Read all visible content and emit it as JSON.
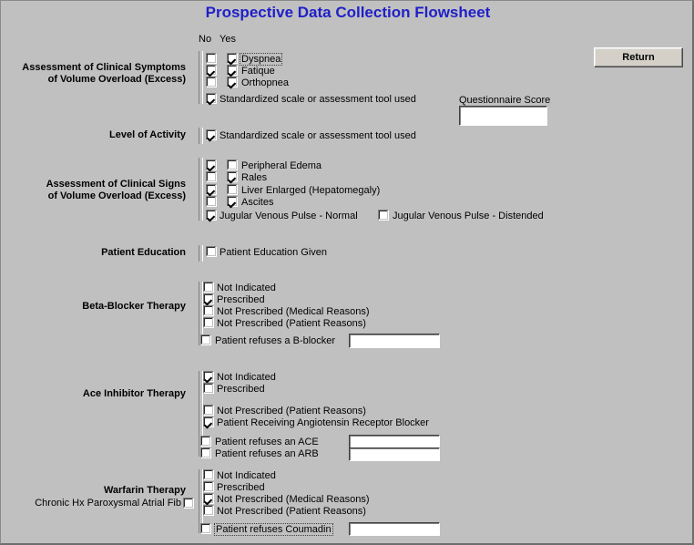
{
  "window": {
    "title": "Prospective Data Collection Flowsheet",
    "background_color": "#c0c0c0",
    "title_color": "#2020c8"
  },
  "buttons": {
    "return_label": "Return"
  },
  "column_headers": {
    "no": "No",
    "yes": "Yes"
  },
  "questionnaire": {
    "label": "Questionnaire Score",
    "value": "",
    "placeholder": ""
  },
  "sections": [
    {
      "id": "clinical-symptoms",
      "label": "Assessment of Clinical Symptoms\nof Volume Overload (Excess)",
      "rows": [
        {
          "text": "Dyspnea",
          "no": false,
          "yes": true,
          "focus": true
        },
        {
          "text": "Fatique",
          "no": true,
          "yes": true,
          "focus": false
        },
        {
          "text": "Orthopnea",
          "no": false,
          "yes": true,
          "focus": false
        }
      ],
      "single": {
        "text": "Standardized scale or assessment tool used",
        "checked": true
      }
    },
    {
      "id": "level-of-activity",
      "label": "Level of Activity",
      "single": {
        "text": "Standardized scale or assessment tool used",
        "checked": true
      }
    },
    {
      "id": "clinical-signs",
      "label": "Assessment of Clinical Signs\nof Volume Overload (Excess)",
      "rows": [
        {
          "text": "Peripheral Edema",
          "no": true,
          "yes": false,
          "focus": false
        },
        {
          "text": "Rales",
          "no": false,
          "yes": true,
          "focus": false
        },
        {
          "text": "Liver Enlarged (Hepatomegaly)",
          "no": true,
          "yes": false,
          "focus": false
        },
        {
          "text": "Ascites",
          "no": false,
          "yes": true,
          "focus": false
        }
      ],
      "single": {
        "text": "Jugular Venous Pulse - Normal",
        "checked": true
      },
      "extra": {
        "text": "Jugular Venous Pulse - Distended",
        "checked": false
      }
    },
    {
      "id": "patient-education",
      "label": "Patient Education",
      "single": {
        "text": "Patient Education Given",
        "checked": false
      }
    },
    {
      "id": "beta-blocker-therapy",
      "label": "Beta-Blocker Therapy",
      "options": [
        {
          "text": "Not Indicated",
          "checked": false
        },
        {
          "text": "Prescribed",
          "checked": true
        },
        {
          "text": "Not Prescribed (Medical Reasons)",
          "checked": false
        },
        {
          "text": "Not Prescribed (Patient Reasons)",
          "checked": false
        }
      ],
      "refusals": [
        {
          "text": "Patient refuses a B-blocker",
          "checked": false,
          "value": "",
          "focus": false
        }
      ]
    },
    {
      "id": "ace-inhibitor-therapy",
      "label": "Ace Inhibitor Therapy",
      "options": [
        {
          "text": "Not Indicated",
          "checked": true
        },
        {
          "text": "Prescribed",
          "checked": false
        }
      ],
      "options2": [
        {
          "text": "Not Prescribed (Patient Reasons)",
          "checked": false
        },
        {
          "text": "Patient Receiving Angiotensin Receptor Blocker",
          "checked": true
        }
      ],
      "refusals": [
        {
          "text": "Patient refuses an ACE",
          "checked": false,
          "value": "",
          "focus": false
        },
        {
          "text": "Patient refuses an ARB",
          "checked": false,
          "value": "",
          "focus": false
        }
      ]
    },
    {
      "id": "warfarin-therapy",
      "label": "Warfarin Therapy",
      "sublabel": "Chronic Hx Paroxysmal Atrial Fib",
      "sublabel_checked": false,
      "options": [
        {
          "text": "Not Indicated",
          "checked": false
        },
        {
          "text": "Prescribed",
          "checked": false
        },
        {
          "text": "Not Prescribed (Medical Reasons)",
          "checked": true
        },
        {
          "text": "Not Prescribed (Patient Reasons)",
          "checked": false
        }
      ],
      "refusals": [
        {
          "text": "Patient refuses Coumadin",
          "checked": false,
          "value": "",
          "focus": true
        }
      ]
    }
  ]
}
